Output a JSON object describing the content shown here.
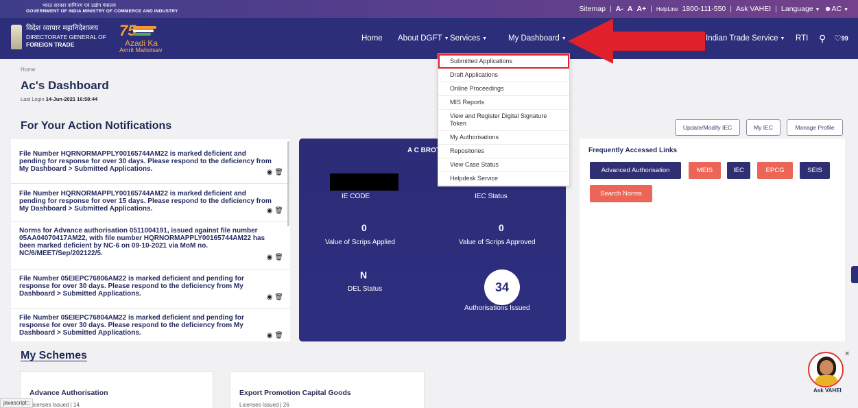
{
  "gov": {
    "line1": "भारत सरकार  वाणिज्य एवं उद्योग मंत्रालय",
    "line2": "GOVERNMENT OF INDIA  MINISTRY OF COMMERCE AND INDUSTRY"
  },
  "utility": {
    "sitemap": "Sitemap",
    "font_minus": "A-",
    "font_normal": "A",
    "font_plus": "A+",
    "helpline_label": "HelpLine",
    "helpline_number": "1800-111-550",
    "ask_vahei": "Ask VAHEI",
    "language": "Language",
    "user": "AC",
    "sep": "|"
  },
  "brand": {
    "hindi": "विदेश व्यापार महानिदेशालय",
    "line1": "DIRECTORATE GENERAL OF",
    "line2": "FOREIGN TRADE",
    "azadi_num": "75",
    "azadi_1": "Azadi Ka",
    "azadi_2": "Amrit Mahotsav"
  },
  "nav": {
    "home": "Home",
    "about": "About DGFT",
    "services": "Services",
    "dashboard": "My Dashboard",
    "its": "Indian Trade Service",
    "rti": "RTI",
    "notif_count": "99"
  },
  "dropdown": [
    "Submitted Applications",
    "Draft Applications",
    "Online Proceedings",
    "MIS Reports",
    "View and Register Digital Signature Token",
    "My Authorisations",
    "Repositories",
    "View Case Status",
    "Helpdesk Service"
  ],
  "page": {
    "breadcrumb": "Home",
    "title": "Ac's Dashboard",
    "last_login_label": "Last Login",
    "last_login_value": "14-Jun-2021 16:58:44",
    "notifications_title": "For Your Action Notifications",
    "btn_update_iec": "Update/Modify IEC",
    "btn_my_iec": "My IEC",
    "btn_manage_profile": "Manage Profile"
  },
  "notifications": [
    "File Number HQRNORMAPPLY00165744AM22 is marked deficient and pending for response for over 30 days. Please respond to the deficiency from My Dashboard > Submitted Applications.",
    "File Number HQRNORMAPPLY00165744AM22 is marked deficient and pending for response for over 15 days. Please respond to the deficiency from My Dashboard > Submitted Applications.",
    "Norms for Advance authorisation 0511004191, issued against file number 05AA04070417AM22, with file number HQRNORMAPPLY00165744AM22 has been marked deficient by NC-6 on 09-10-2021 via MoM no. NC/6/MEET/Sep/202122/5.",
    "File Number 05EIEPC76806AM22 is marked deficient and pending for response for over 30 days. Please respond to the deficiency from My Dashboard > Submitted Applications.",
    "File Number 05EIEPC76804AM22 is marked deficient and pending for response for over 30 days. Please respond to the deficiency from My Dashboard > Submitted Applications."
  ],
  "summary": {
    "name": "A C BROT",
    "ie_code_label": "IE CODE",
    "iec_status_label": "IEC Status",
    "scrips_applied_value": "0",
    "scrips_applied_label": "Value of Scrips Applied",
    "scrips_approved_value": "0",
    "scrips_approved_label": "Value of Scrips Approved",
    "del_value": "N",
    "del_label": "DEL Status",
    "auth_value": "34",
    "auth_label": "Authorisations Issued"
  },
  "links": {
    "title": "Frequently Accessed Links",
    "advanced": "Advanced Authorisation",
    "meis": "MEIS",
    "iec": "IEC",
    "epcg": "EPCG",
    "seis": "SEIS",
    "search": "Search Norms"
  },
  "schemes": {
    "title": "My Schemes",
    "s1_name": "Advance Authorisation",
    "s1_licenses": "Licenses Issued | 14",
    "s2_name": "Export Promotion Capital Goods",
    "s2_licenses": "Licenses Issued | 26"
  },
  "status_text": "javascript:;",
  "vahei": {
    "label": "Ask VAHEI",
    "close": "×"
  },
  "colors": {
    "navy": "#2d2e7a",
    "coral": "#ec6657",
    "accent_red": "#e0202b"
  }
}
